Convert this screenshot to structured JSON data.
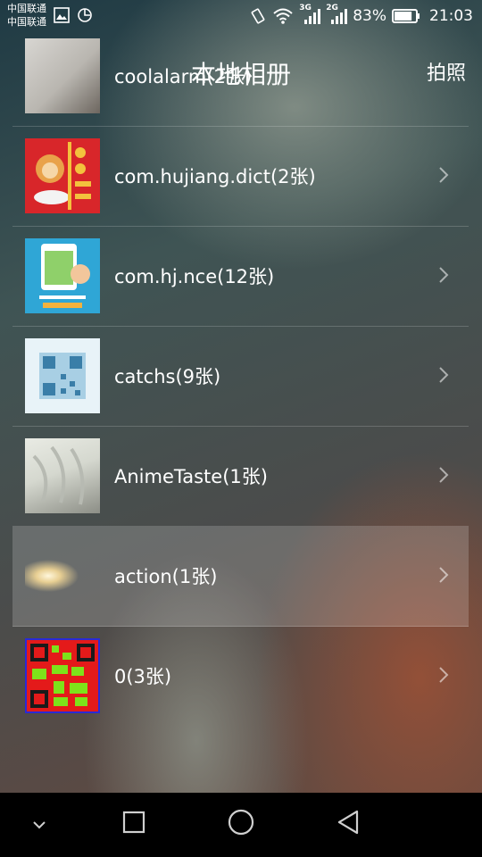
{
  "status_bar": {
    "carrier_1": "中国联通",
    "carrier_2": "中国联通",
    "net_1": "3G",
    "net_2": "2G",
    "battery": "83%",
    "battery_level": 0.83,
    "time": "21:03",
    "icons": [
      "gallery-icon",
      "sync-icon",
      "vibrate-icon",
      "wifi-icon",
      "signal-icon",
      "signal-icon",
      "battery-icon"
    ]
  },
  "header": {
    "title": "本地相册",
    "camera_label": "拍照"
  },
  "albums": [
    {
      "label": "coolalarm(2张)"
    },
    {
      "label": "com.hujiang.dict(2张)"
    },
    {
      "label": "com.hj.nce(12张)"
    },
    {
      "label": "catchs(9张)"
    },
    {
      "label": "AnimeTaste(1张)"
    },
    {
      "label": "action(1张)",
      "selected": true
    },
    {
      "label": "0(3张)"
    }
  ],
  "navbar": {
    "icons": [
      "hide-nav-icon",
      "recents-icon",
      "home-icon",
      "back-icon"
    ]
  }
}
